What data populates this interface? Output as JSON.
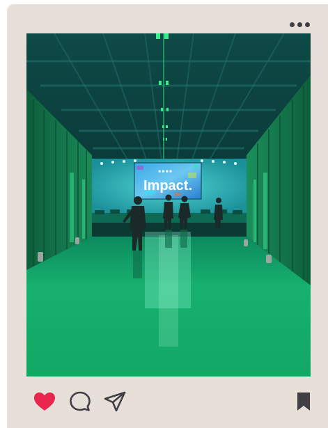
{
  "post": {
    "photo": {
      "screen_text": "Impact.",
      "screen_subtext": "■ ■ ■ ■"
    },
    "icons": {
      "more": "more-horizontal-icon",
      "like": "heart-icon",
      "comment": "comment-bubble-icon",
      "share": "send-icon",
      "save": "bookmark-icon"
    },
    "state": {
      "liked": true,
      "saved": true
    }
  },
  "colors": {
    "card_background": "#e7e0d9",
    "like_active": "#e8264f",
    "icon": "#3f3f44",
    "photo_accent": "#1fd08a"
  }
}
